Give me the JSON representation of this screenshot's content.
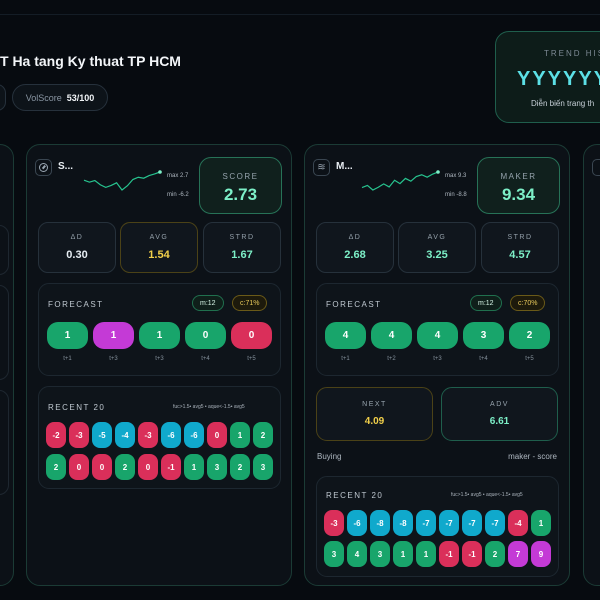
{
  "header": {
    "title": "T Ha tang Ky thuat TP HCM",
    "volscore_label": "VolScore",
    "volscore_value": "53/100"
  },
  "trend": {
    "label": "TREND HIS",
    "value": "YYYYYYY",
    "description": "Diễn biến trang th"
  },
  "panels": [
    {
      "name": "S...",
      "icon": "gauge-icon",
      "spark_max": "max 2.7",
      "spark_min": "min -6.2",
      "score_label": "SCORE",
      "score_value": "2.73",
      "stats": [
        {
          "label": "ΔD",
          "value": "0.30",
          "color": "#e6edf3"
        },
        {
          "label": "AVG",
          "value": "1.54",
          "color": "#f2d04a"
        },
        {
          "label": "STRD",
          "value": "1.67",
          "color": "#7df0c8"
        }
      ],
      "forecast": {
        "title": "FORECAST",
        "m": "m:12",
        "c": "c:71%",
        "items": [
          {
            "value": "1",
            "label": "t+1",
            "color": "green"
          },
          {
            "value": "1",
            "label": "t+3",
            "color": "magenta"
          },
          {
            "value": "1",
            "label": "t+3",
            "color": "green"
          },
          {
            "value": "0",
            "label": "t+4",
            "color": "green"
          },
          {
            "value": "0",
            "label": "t+5",
            "color": "red"
          }
        ]
      },
      "recent": {
        "title": "RECENT 20",
        "note": "fuc>1.5• avg5 • aque<-1.5• avg5",
        "row1": [
          {
            "v": "-2",
            "c": "red"
          },
          {
            "v": "-3",
            "c": "red"
          },
          {
            "v": "-5",
            "c": "cyan"
          },
          {
            "v": "-4",
            "c": "cyan"
          },
          {
            "v": "-3",
            "c": "red"
          },
          {
            "v": "-6",
            "c": "cyan"
          },
          {
            "v": "-6",
            "c": "cyan"
          },
          {
            "v": "0",
            "c": "red"
          },
          {
            "v": "1",
            "c": "green"
          },
          {
            "v": "2",
            "c": "green"
          }
        ],
        "row2": [
          {
            "v": "2",
            "c": "green"
          },
          {
            "v": "0",
            "c": "red"
          },
          {
            "v": "0",
            "c": "red"
          },
          {
            "v": "2",
            "c": "green"
          },
          {
            "v": "0",
            "c": "red"
          },
          {
            "v": "-1",
            "c": "red"
          },
          {
            "v": "1",
            "c": "green"
          },
          {
            "v": "3",
            "c": "green"
          },
          {
            "v": "2",
            "c": "green"
          },
          {
            "v": "3",
            "c": "green"
          }
        ]
      }
    },
    {
      "name": "M...",
      "icon": "waves-icon",
      "spark_max": "max 9.3",
      "spark_min": "min -8.8",
      "score_label": "MAKER",
      "score_value": "9.34",
      "stats": [
        {
          "label": "ΔD",
          "value": "2.68",
          "color": "#7df0c8"
        },
        {
          "label": "AVG",
          "value": "3.25",
          "color": "#7df0c8"
        },
        {
          "label": "STRD",
          "value": "4.57",
          "color": "#7df0c8"
        }
      ],
      "forecast": {
        "title": "FORECAST",
        "m": "m:12",
        "c": "c:70%",
        "items": [
          {
            "value": "4",
            "label": "t+1",
            "color": "green"
          },
          {
            "value": "4",
            "label": "t+2",
            "color": "green"
          },
          {
            "value": "4",
            "label": "t+3",
            "color": "green"
          },
          {
            "value": "3",
            "label": "t+4",
            "color": "green"
          },
          {
            "value": "2",
            "label": "t+5",
            "color": "green"
          }
        ]
      },
      "next": {
        "label": "NEXT",
        "value": "4.09"
      },
      "adv": {
        "label": "ADV",
        "value": "6.61"
      },
      "foot_left": "Buying",
      "foot_right": "maker - score",
      "recent": {
        "title": "RECENT 20",
        "note": "fuc>1.5• avg5 • aque<-1.5• avg5",
        "row1": [
          {
            "v": "-3",
            "c": "red"
          },
          {
            "v": "-6",
            "c": "cyan"
          },
          {
            "v": "-8",
            "c": "cyan"
          },
          {
            "v": "-8",
            "c": "cyan"
          },
          {
            "v": "-7",
            "c": "cyan"
          },
          {
            "v": "-7",
            "c": "cyan"
          },
          {
            "v": "-7",
            "c": "cyan"
          },
          {
            "v": "-7",
            "c": "cyan"
          },
          {
            "v": "-4",
            "c": "red"
          },
          {
            "v": "1",
            "c": "green"
          }
        ],
        "row2": [
          {
            "v": "3",
            "c": "green"
          },
          {
            "v": "4",
            "c": "green"
          },
          {
            "v": "3",
            "c": "green"
          },
          {
            "v": "1",
            "c": "green"
          },
          {
            "v": "1",
            "c": "green"
          },
          {
            "v": "-1",
            "c": "red"
          },
          {
            "v": "-1",
            "c": "red"
          },
          {
            "v": "2",
            "c": "green"
          },
          {
            "v": "7",
            "c": "magenta"
          },
          {
            "v": "9",
            "c": "magenta"
          }
        ]
      }
    }
  ],
  "spark_series": [
    [
      0.2,
      -0.4,
      0.1,
      -1.2,
      -2.0,
      -1.4,
      -0.6,
      -2.8,
      -1.5,
      0.4,
      1.1,
      0.8,
      1.6,
      2.1,
      2.7
    ],
    [
      -1.0,
      -0.3,
      -1.8,
      -0.9,
      0.2,
      -0.8,
      1.4,
      0.3,
      2.0,
      1.1,
      2.6,
      3.2,
      2.4,
      3.4,
      4.1
    ]
  ],
  "colors": {
    "green": "#18a56b",
    "red": "#da2f5a",
    "cyan": "#10a9cc",
    "magenta": "#c43ad6",
    "accent": "#7df0c8",
    "yellow": "#f2d04a"
  }
}
